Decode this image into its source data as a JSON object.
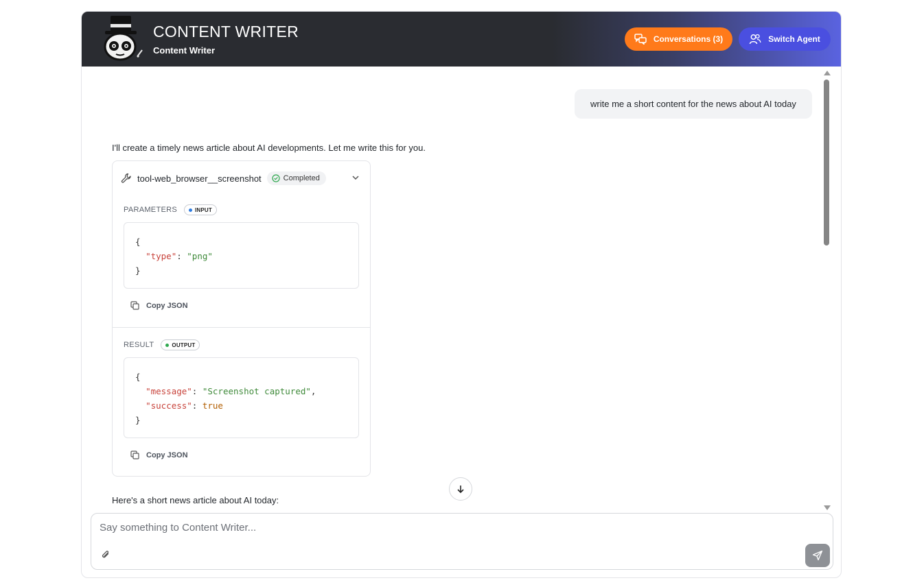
{
  "header": {
    "title": "CONTENT WRITER",
    "subtitle": "Content Writer",
    "conversations_label": "Conversations (3)",
    "switch_agent_label": "Switch Agent"
  },
  "chat": {
    "user_message": "write me a short content for the news about AI today",
    "assistant_intro": "I'll create a timely news article about AI developments. Let me write this for you.",
    "assistant_followup": "Here's a short news article about AI today:"
  },
  "tool_call": {
    "name": "tool-web_browser__screenshot",
    "status": "Completed",
    "parameters_label": "PARAMETERS",
    "input_pill": "INPUT",
    "parameters_json": {
      "open": "{",
      "key1": "\"type\"",
      "val1": "\"png\"",
      "close": "}"
    },
    "copy_label": "Copy JSON",
    "result_label": "RESULT",
    "output_pill": "OUTPUT",
    "result_json": {
      "open": "{",
      "key1": "\"message\"",
      "val1": "\"Screenshot captured\"",
      "key2": "\"success\"",
      "val2": "true",
      "close": "}"
    }
  },
  "composer": {
    "placeholder": "Say something to Content Writer..."
  },
  "colors": {
    "orange": "#ff7a1a",
    "indigo": "#4a4fe0",
    "header_dark": "#2a2c31",
    "json_key": "#c8433b",
    "json_string": "#3f8a3a",
    "json_bool": "#b25e00",
    "completed_green": "#2fa84f",
    "input_dot": "#2f7de1",
    "output_dot": "#2fa84f"
  },
  "icons": {
    "conversations": "chat-bubbles-icon",
    "switch_agent": "users-icon",
    "tool": "wrench-icon",
    "status": "check-circle-icon",
    "expand": "chevron-down-icon",
    "copy": "copy-icon",
    "scroll": "arrow-down-icon",
    "attach": "paperclip-icon",
    "send": "send-icon"
  }
}
